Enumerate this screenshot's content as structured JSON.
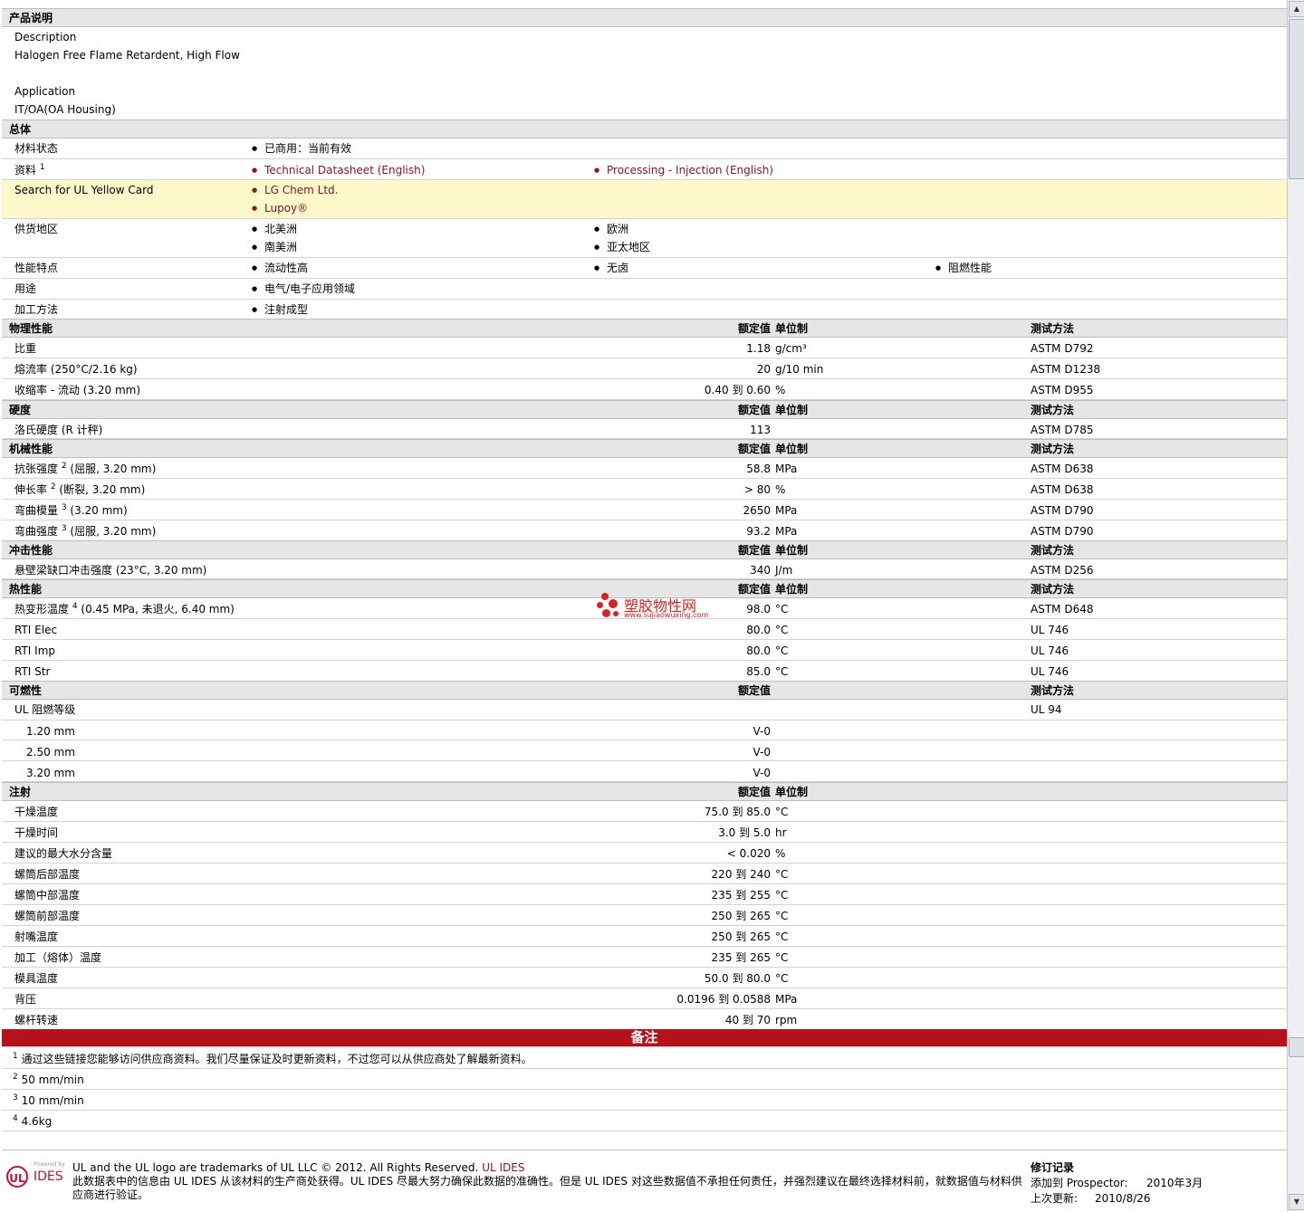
{
  "desc": {
    "section": "产品说明",
    "desc_label": "Description",
    "desc_value": "Halogen Free Flame Retardent, High Flow",
    "app_label": "Application",
    "app_value": "IT/OA(OA Housing)"
  },
  "general": {
    "section": "总体",
    "status_label": "材料状态",
    "status_value": "已商用：当前有效",
    "docs_label": "资料",
    "docs_sup": "1",
    "docs_link1": "Technical Datasheet (English)",
    "docs_link2": "Processing - Injection (English)",
    "ul_label": "Search for UL Yellow Card",
    "ul_link1": "LG Chem Ltd.",
    "ul_link2": "Lupoy®",
    "region_label": "供货地区",
    "region1": "北美洲",
    "region2": "南美洲",
    "region3": "欧洲",
    "region4": "亚太地区",
    "feat_label": "性能特点",
    "feat1": "流动性高",
    "feat2": "无卤",
    "feat3": "阻燃性能",
    "use_label": "用途",
    "use1": "电气/电子应用领域",
    "proc_label": "加工方法",
    "proc1": "注射成型"
  },
  "hdr": {
    "val": "额定值",
    "unit": "单位制",
    "test": "测试方法"
  },
  "phys": {
    "section": "物理性能",
    "rows": [
      {
        "label": "比重",
        "val": "1.18",
        "unit": "g/cm³",
        "test": "ASTM D792"
      },
      {
        "label": "熔流率  (250°C/2.16 kg)",
        "val": "20",
        "unit": "g/10 min",
        "test": "ASTM D1238"
      },
      {
        "label": "收缩率  - 流动  (3.20 mm)",
        "val": "0.40 到  0.60",
        "unit": "%",
        "test": "ASTM D955"
      }
    ]
  },
  "hard": {
    "section": "硬度",
    "rows": [
      {
        "label": "洛氏硬度  (R 计秤)",
        "val": "113",
        "unit": "",
        "test": "ASTM D785"
      }
    ]
  },
  "mech": {
    "section": "机械性能",
    "rows": [
      {
        "label": "抗张强度",
        "sup": "2",
        "suffix": " (屈服, 3.20 mm)",
        "val": "58.8",
        "unit": "MPa",
        "test": "ASTM D638"
      },
      {
        "label": "伸长率",
        "sup": "2",
        "suffix": " (断裂, 3.20 mm)",
        "val": "> 80",
        "unit": "%",
        "test": "ASTM D638"
      },
      {
        "label": "弯曲模量",
        "sup": "3",
        "suffix": " (3.20 mm)",
        "val": "2650",
        "unit": "MPa",
        "test": "ASTM D790"
      },
      {
        "label": "弯曲强度",
        "sup": "3",
        "suffix": " (屈服, 3.20 mm)",
        "val": "93.2",
        "unit": "MPa",
        "test": "ASTM D790"
      }
    ]
  },
  "impact": {
    "section": "冲击性能",
    "rows": [
      {
        "label": "悬壁梁缺口冲击强度  (23°C, 3.20 mm)",
        "val": "340",
        "unit": "J/m",
        "test": "ASTM D256"
      }
    ]
  },
  "thermal": {
    "section": "热性能",
    "rows": [
      {
        "label": "热变形温度",
        "sup": "4",
        "suffix": " (0.45 MPa, 未退火, 6.40 mm)",
        "val": "98.0",
        "unit": "°C",
        "test": "ASTM D648"
      },
      {
        "label": "RTI Elec",
        "val": "80.0",
        "unit": "°C",
        "test": "UL 746"
      },
      {
        "label": "RTI Imp",
        "val": "80.0",
        "unit": "°C",
        "test": "UL 746"
      },
      {
        "label": "RTI Str",
        "val": "85.0",
        "unit": "°C",
        "test": "UL 746"
      }
    ]
  },
  "flam": {
    "section": "可燃性",
    "main_label": "UL 阻燃等级",
    "main_test": "UL 94",
    "rows": [
      {
        "label": "1.20 mm",
        "val": "V-0"
      },
      {
        "label": "2.50 mm",
        "val": "V-0"
      },
      {
        "label": "3.20 mm",
        "val": "V-0"
      }
    ]
  },
  "inj": {
    "section": "注射",
    "rows": [
      {
        "label": "干燥温度",
        "val": "75.0 到  85.0",
        "unit": "°C"
      },
      {
        "label": "干燥时间",
        "val": "3.0 到  5.0",
        "unit": "hr"
      },
      {
        "label": "建议的最大水分含量",
        "val": "< 0.020",
        "unit": "%"
      },
      {
        "label": "螺筒后部温度",
        "val": "220 到  240",
        "unit": "°C"
      },
      {
        "label": "螺筒中部温度",
        "val": "235 到  255",
        "unit": "°C"
      },
      {
        "label": "螺筒前部温度",
        "val": "250 到  265",
        "unit": "°C"
      },
      {
        "label": "射嘴温度",
        "val": "250 到  265",
        "unit": "°C"
      },
      {
        "label": "加工（熔体）温度",
        "val": "235 到  265",
        "unit": "°C"
      },
      {
        "label": "模具温度",
        "val": "50.0 到  80.0",
        "unit": "°C"
      },
      {
        "label": "背压",
        "val": "0.0196 到  0.0588",
        "unit": "MPa"
      },
      {
        "label": "螺杆转速",
        "val": "40 到  70",
        "unit": "rpm"
      }
    ]
  },
  "notes": {
    "title": "备注",
    "items": [
      {
        "sup": "1",
        "text": "通过这些链接您能够访问供应商资料。我们尽量保证及时更新资料，不过您可以从供应商处了解最新资料。"
      },
      {
        "sup": "2",
        "text": "50 mm/min"
      },
      {
        "sup": "3",
        "text": "10 mm/min"
      },
      {
        "sup": "4",
        "text": "4.6kg"
      }
    ]
  },
  "watermark": {
    "cn": "塑胶物性网",
    "url": "www.sujiaowuxing.com"
  },
  "footer": {
    "logo_small": "Powered by",
    "logo_ul": "UL",
    "logo_ides": "IDES",
    "trademark": "UL and the UL logo are trademarks of UL LLC © 2012. All Rights Reserved.",
    "ul_link": "UL IDES",
    "disclaimer": "此数据表中的信息由  UL IDES 从该材料的生产商处获得。UL IDES 尽最大努力确保此数据的准确性。但是  UL IDES 对这些数据值不承担任何责任，并强烈建议在最终选择材料前，就数据值与材料供应商进行验证。",
    "rev_title": "修订记录",
    "added_label": "添加到  Prospector:",
    "added_value": "2010年3月",
    "updated_label": "上次更新:",
    "updated_value": "2010/8/26"
  },
  "colors": {
    "link": "#8a1528",
    "notes_bar": "#b5121b",
    "highlight": "#fdf8ca",
    "section_bg": "#e6e6e6"
  },
  "icons": {
    "scroll_up": "chevron-up-icon",
    "scroll_down": "chevron-down-icon",
    "bullet": "bullet-icon"
  }
}
